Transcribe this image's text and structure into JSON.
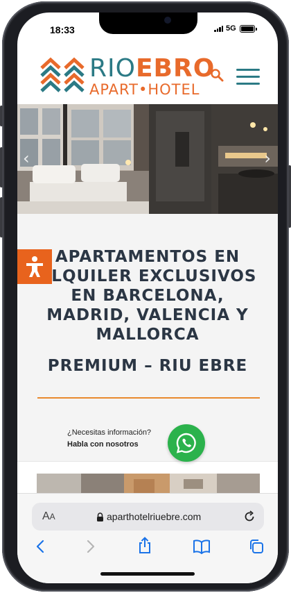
{
  "status_bar": {
    "time": "18:33",
    "network": "5G"
  },
  "header": {
    "brand_part1": "RIO",
    "brand_part2": "EBRO",
    "brand_sub": "APART•HOTEL",
    "accent_teal": "#2b7a85",
    "accent_orange": "#e86a2b"
  },
  "hero": {
    "prev_icon": "chevron-left-icon",
    "next_icon": "chevron-right-icon"
  },
  "main": {
    "headline": "APARTAMENTOS EN ALQUILER EXCLUSIVOS EN BARCELONA, MADRID, VALENCIA Y MALLORCA",
    "subheadline": "PREMIUM – RIU EBRE"
  },
  "whatsapp": {
    "line1": "¿Necesitas información?",
    "line2": "Habla con nosotros",
    "color": "#2bb24c"
  },
  "accessibility": {
    "icon": "accessibility-icon",
    "color": "#e8631d"
  },
  "safari": {
    "aa_label": "A",
    "aa_small": "A",
    "url": "aparthotelriuebre.com"
  }
}
